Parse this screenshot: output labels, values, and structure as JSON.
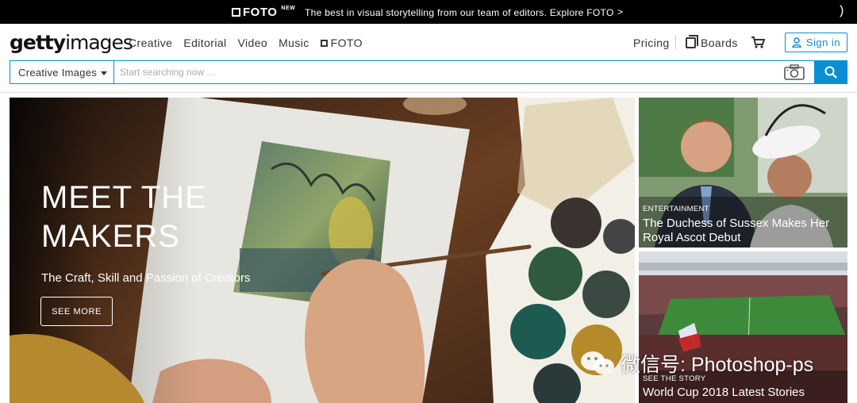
{
  "promo": {
    "logo": "FOTO",
    "logo_sup": "NEW",
    "text": "The best in visual storytelling from our team of editors. Explore FOTO",
    "arrow": ">",
    "close": ")"
  },
  "header": {
    "logo_bold": "getty",
    "logo_rest": "images",
    "nav": [
      "Creative",
      "Editorial",
      "Video",
      "Music",
      "FOTO"
    ],
    "pricing": "Pricing",
    "boards": "Boards",
    "signin": "Sign in"
  },
  "search": {
    "category": "Creative Images",
    "placeholder": "Start searching now ..."
  },
  "hero": {
    "title_line1": "MEET THE",
    "title_line2": "MAKERS",
    "subtitle": "The Craft, Skill and Passion of Creators",
    "button": "SEE MORE"
  },
  "cards": [
    {
      "tag": "ENTERTAINMENT",
      "title_line1": "The Duchess of Sussex Makes Her",
      "title_line2": "Royal Ascot Debut"
    },
    {
      "tag": "SEE THE STORY",
      "title": "World Cup 2018 Latest Stories"
    }
  ],
  "watermark": "微信号: Photoshop-ps",
  "colors": {
    "accent": "#0b8ed3",
    "promo_bg": "#000000"
  },
  "icons": [
    "foto-icon",
    "boards-icon",
    "cart-icon",
    "user-icon",
    "camera-icon",
    "search-icon",
    "wechat-icon"
  ]
}
